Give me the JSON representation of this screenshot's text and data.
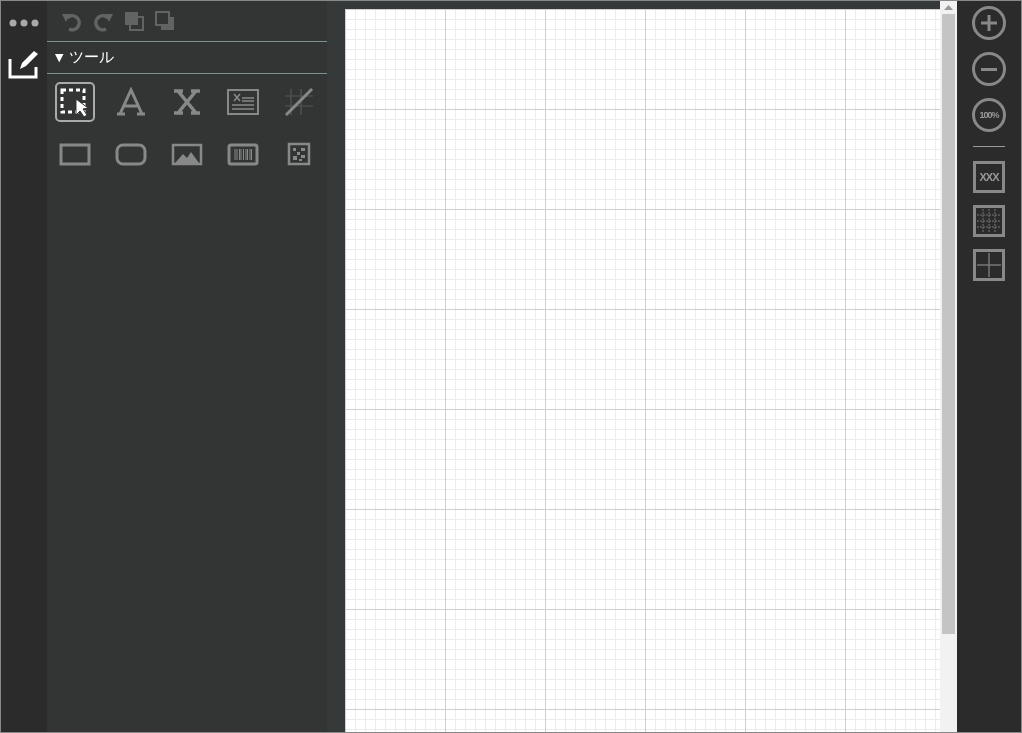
{
  "top_actions": [
    {
      "kind": "undo",
      "disabled": true
    },
    {
      "kind": "redo",
      "disabled": true
    },
    {
      "kind": "bring_front",
      "disabled": true
    },
    {
      "kind": "send_back",
      "disabled": true
    }
  ],
  "section": {
    "arrow": "▼",
    "title": "ツール"
  },
  "tools": [
    {
      "kind": "select",
      "selected": true
    },
    {
      "kind": "text",
      "selected": false
    },
    {
      "kind": "field",
      "selected": false
    },
    {
      "kind": "textbox",
      "selected": false
    },
    {
      "kind": "line",
      "selected": false
    },
    {
      "kind": "rect",
      "selected": false
    },
    {
      "kind": "rounded_rect",
      "selected": false
    },
    {
      "kind": "image",
      "selected": false
    },
    {
      "kind": "barcode",
      "selected": false
    },
    {
      "kind": "qrcode",
      "selected": false
    }
  ],
  "zoom_controls": [
    {
      "kind": "zoom_in"
    },
    {
      "kind": "zoom_out"
    },
    {
      "kind": "reset",
      "label": "100%"
    }
  ],
  "view_toggles": [
    {
      "kind": "labels",
      "label": "XXX"
    },
    {
      "kind": "fine_grid"
    },
    {
      "kind": "grid"
    }
  ]
}
